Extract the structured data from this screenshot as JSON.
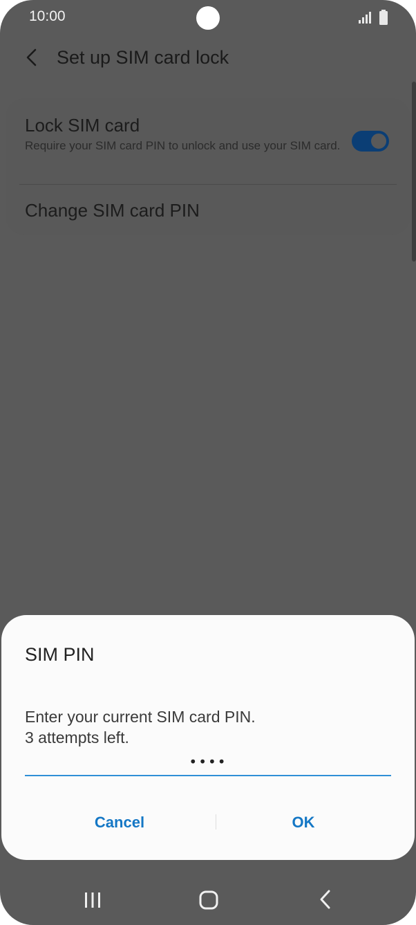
{
  "status_bar": {
    "time": "10:00",
    "icons": [
      "signal-icon",
      "battery-icon"
    ]
  },
  "header": {
    "title": "Set up SIM card lock",
    "back_icon": "chevron-left-icon"
  },
  "settings": {
    "lock_sim": {
      "title": "Lock SIM card",
      "subtitle": "Require your SIM card PIN to unlock and use your SIM card.",
      "enabled": true
    },
    "change_pin": {
      "title": "Change SIM card PIN"
    }
  },
  "dialog": {
    "title": "SIM PIN",
    "message_line1": "Enter your current SIM card PIN.",
    "message_line2": "3 attempts left.",
    "pin_value": "••••",
    "cancel_label": "Cancel",
    "ok_label": "OK"
  },
  "nav_bar": {
    "icons": [
      "recents-icon",
      "home-icon",
      "back-icon"
    ]
  },
  "colors": {
    "accent": "#1477c5",
    "toggle_on": "#0b3e75",
    "scrim": "#5a5a5a",
    "dialog_bg": "#fbfbfb"
  }
}
